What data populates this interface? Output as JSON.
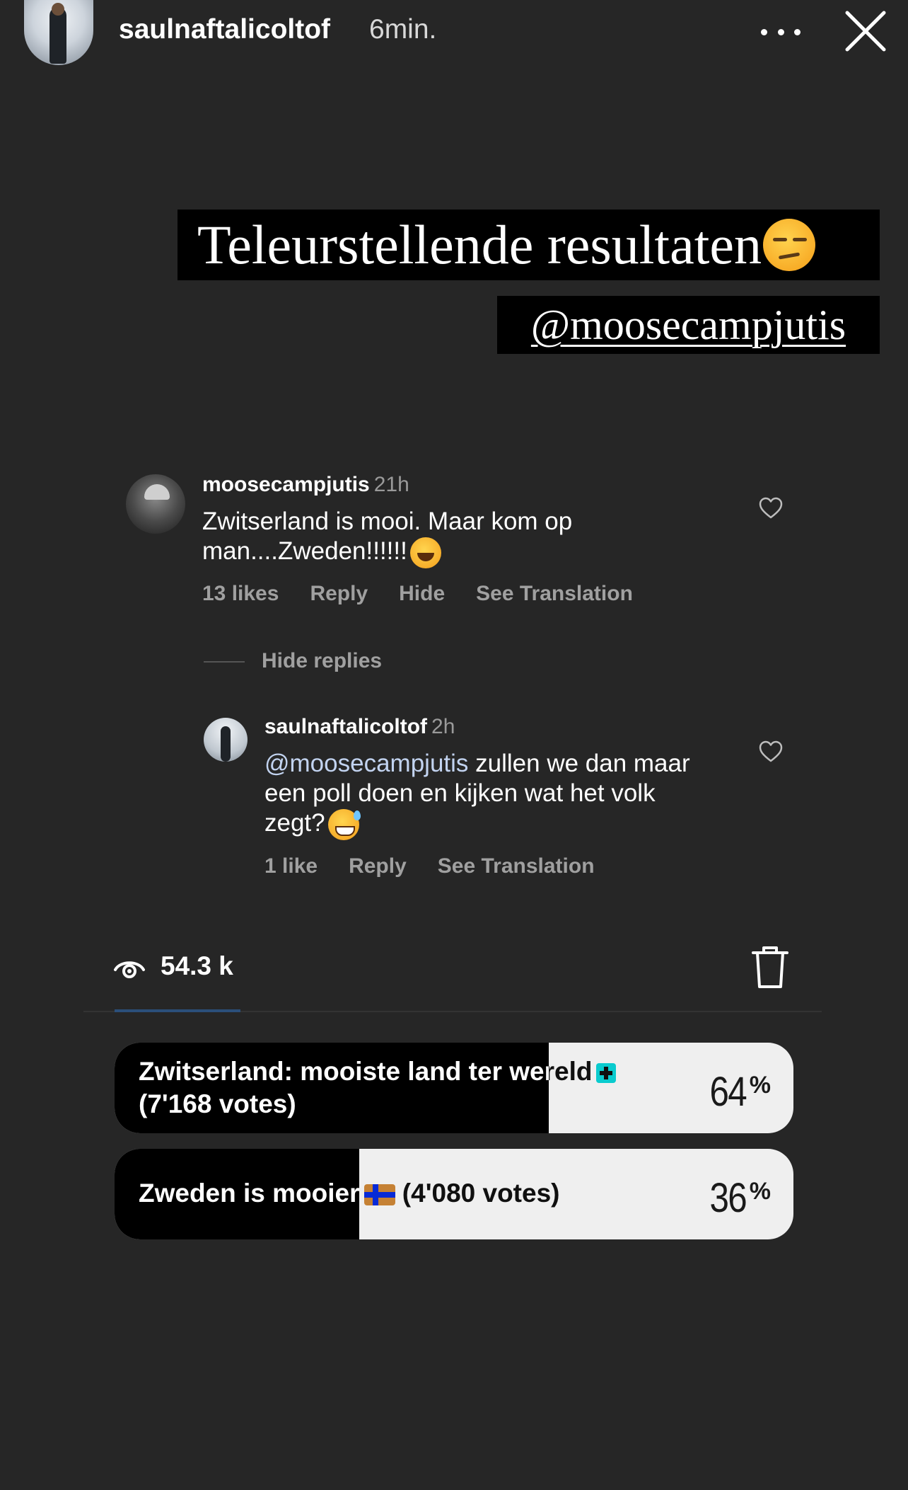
{
  "story": {
    "username": "saulnaftalicoltof",
    "time": "6min."
  },
  "stickers": {
    "title": "Teleurstellende resultaten",
    "title_emoji": "unamused-face-emoji",
    "mention": "@moosecampjutis"
  },
  "comments": [
    {
      "username": "moosecampjutis",
      "time": "21h",
      "text_line1": "Zwitserland is mooi. Maar kom op",
      "text_line2": "man....Zweden!!!!!!",
      "emoji": "tears-of-joy-emoji",
      "likes": "13 likes",
      "reply": "Reply",
      "hide": "Hide",
      "translate": "See Translation"
    }
  ],
  "hide_replies": "Hide replies",
  "reply": {
    "username": "saulnaftalicoltof",
    "time": "2h",
    "mention": "@moosecampjutis",
    "text_line1": " zullen we dan maar",
    "text_line2": "een poll doen en kijken wat het volk",
    "text_line3": "zegt?",
    "emoji": "grinning-sweat-emoji",
    "likes": "1 like",
    "reply": "Reply",
    "translate": "See Translation"
  },
  "viewers": {
    "count": "54.3 k"
  },
  "poll": [
    {
      "label_line1": "Zwitserland: mooiste land ter wereld",
      "label_line2": "(7'168 votes)",
      "flag": "swiss-flag",
      "percent": "64",
      "percent_value": 64
    },
    {
      "label": "Zweden is mooier",
      "votes": " (4'080 votes)",
      "flag": "swedish-flag",
      "percent": "36",
      "percent_value": 36
    }
  ],
  "colors": {
    "background": "#262626",
    "poll_fill": "#000000",
    "poll_track": "#efefef",
    "mention": "#c2d3f0"
  }
}
